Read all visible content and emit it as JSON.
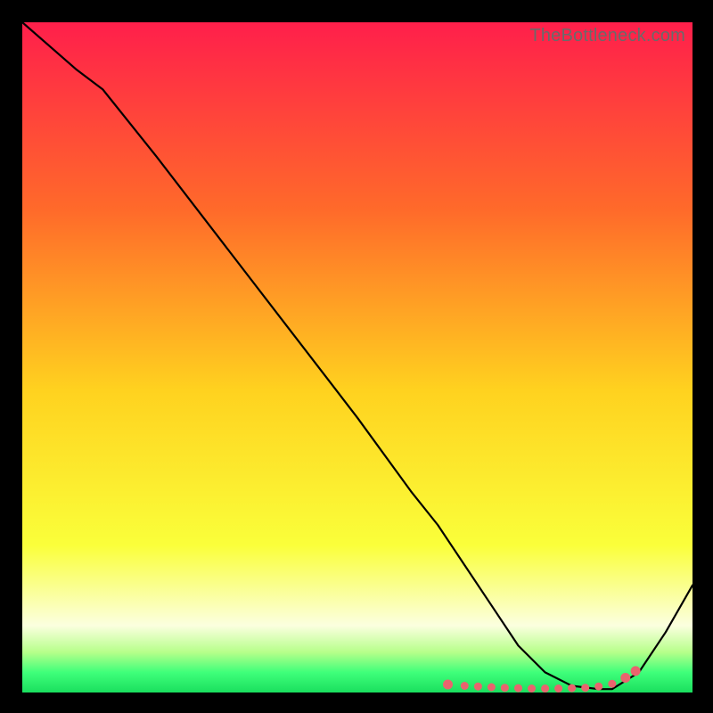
{
  "watermark": "TheBottleneck.com",
  "colors": {
    "bg": "#000000",
    "grad_top": "#ff1f4b",
    "grad_upper_mid": "#ff6a2a",
    "grad_mid": "#ffd21f",
    "grad_lower_mid": "#faff3a",
    "grad_pale": "#fbffdf",
    "grad_green1": "#b6ff8a",
    "grad_green2": "#3fff7a",
    "grad_green3": "#1adf5e",
    "line": "#000000",
    "markers": "#e9646e"
  },
  "chart_data": {
    "type": "line",
    "title": "",
    "xlabel": "",
    "ylabel": "",
    "xlim": [
      0,
      100
    ],
    "ylim": [
      0,
      100
    ],
    "grid": false,
    "legend": false,
    "series": [
      {
        "name": "curve",
        "x": [
          0,
          8,
          12,
          20,
          30,
          40,
          50,
          58,
          62,
          66,
          70,
          74,
          78,
          82,
          86,
          88,
          92,
          96,
          100
        ],
        "y": [
          100,
          93,
          90,
          80,
          67,
          54,
          41,
          30,
          25,
          19,
          13,
          7,
          3,
          1,
          0.5,
          0.5,
          3,
          9,
          16
        ]
      }
    ],
    "markers": {
      "name": "highlight-dots",
      "x": [
        63.5,
        66,
        68,
        70,
        72,
        74,
        76,
        78,
        80,
        82,
        84,
        86,
        88,
        90,
        91.5
      ],
      "y": [
        1.2,
        1.0,
        0.9,
        0.8,
        0.7,
        0.65,
        0.6,
        0.6,
        0.6,
        0.65,
        0.7,
        0.9,
        1.3,
        2.2,
        3.2
      ]
    }
  }
}
